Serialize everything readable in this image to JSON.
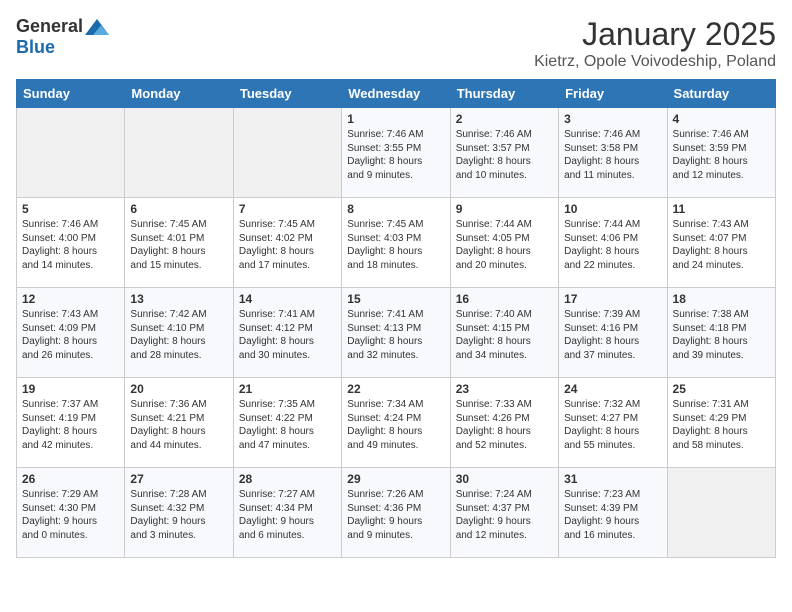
{
  "logo": {
    "general": "General",
    "blue": "Blue"
  },
  "title": "January 2025",
  "location": "Kietrz, Opole Voivodeship, Poland",
  "days_of_week": [
    "Sunday",
    "Monday",
    "Tuesday",
    "Wednesday",
    "Thursday",
    "Friday",
    "Saturday"
  ],
  "weeks": [
    [
      {
        "day": "",
        "content": ""
      },
      {
        "day": "",
        "content": ""
      },
      {
        "day": "",
        "content": ""
      },
      {
        "day": "1",
        "content": "Sunrise: 7:46 AM\nSunset: 3:55 PM\nDaylight: 8 hours\nand 9 minutes."
      },
      {
        "day": "2",
        "content": "Sunrise: 7:46 AM\nSunset: 3:57 PM\nDaylight: 8 hours\nand 10 minutes."
      },
      {
        "day": "3",
        "content": "Sunrise: 7:46 AM\nSunset: 3:58 PM\nDaylight: 8 hours\nand 11 minutes."
      },
      {
        "day": "4",
        "content": "Sunrise: 7:46 AM\nSunset: 3:59 PM\nDaylight: 8 hours\nand 12 minutes."
      }
    ],
    [
      {
        "day": "5",
        "content": "Sunrise: 7:46 AM\nSunset: 4:00 PM\nDaylight: 8 hours\nand 14 minutes."
      },
      {
        "day": "6",
        "content": "Sunrise: 7:45 AM\nSunset: 4:01 PM\nDaylight: 8 hours\nand 15 minutes."
      },
      {
        "day": "7",
        "content": "Sunrise: 7:45 AM\nSunset: 4:02 PM\nDaylight: 8 hours\nand 17 minutes."
      },
      {
        "day": "8",
        "content": "Sunrise: 7:45 AM\nSunset: 4:03 PM\nDaylight: 8 hours\nand 18 minutes."
      },
      {
        "day": "9",
        "content": "Sunrise: 7:44 AM\nSunset: 4:05 PM\nDaylight: 8 hours\nand 20 minutes."
      },
      {
        "day": "10",
        "content": "Sunrise: 7:44 AM\nSunset: 4:06 PM\nDaylight: 8 hours\nand 22 minutes."
      },
      {
        "day": "11",
        "content": "Sunrise: 7:43 AM\nSunset: 4:07 PM\nDaylight: 8 hours\nand 24 minutes."
      }
    ],
    [
      {
        "day": "12",
        "content": "Sunrise: 7:43 AM\nSunset: 4:09 PM\nDaylight: 8 hours\nand 26 minutes."
      },
      {
        "day": "13",
        "content": "Sunrise: 7:42 AM\nSunset: 4:10 PM\nDaylight: 8 hours\nand 28 minutes."
      },
      {
        "day": "14",
        "content": "Sunrise: 7:41 AM\nSunset: 4:12 PM\nDaylight: 8 hours\nand 30 minutes."
      },
      {
        "day": "15",
        "content": "Sunrise: 7:41 AM\nSunset: 4:13 PM\nDaylight: 8 hours\nand 32 minutes."
      },
      {
        "day": "16",
        "content": "Sunrise: 7:40 AM\nSunset: 4:15 PM\nDaylight: 8 hours\nand 34 minutes."
      },
      {
        "day": "17",
        "content": "Sunrise: 7:39 AM\nSunset: 4:16 PM\nDaylight: 8 hours\nand 37 minutes."
      },
      {
        "day": "18",
        "content": "Sunrise: 7:38 AM\nSunset: 4:18 PM\nDaylight: 8 hours\nand 39 minutes."
      }
    ],
    [
      {
        "day": "19",
        "content": "Sunrise: 7:37 AM\nSunset: 4:19 PM\nDaylight: 8 hours\nand 42 minutes."
      },
      {
        "day": "20",
        "content": "Sunrise: 7:36 AM\nSunset: 4:21 PM\nDaylight: 8 hours\nand 44 minutes."
      },
      {
        "day": "21",
        "content": "Sunrise: 7:35 AM\nSunset: 4:22 PM\nDaylight: 8 hours\nand 47 minutes."
      },
      {
        "day": "22",
        "content": "Sunrise: 7:34 AM\nSunset: 4:24 PM\nDaylight: 8 hours\nand 49 minutes."
      },
      {
        "day": "23",
        "content": "Sunrise: 7:33 AM\nSunset: 4:26 PM\nDaylight: 8 hours\nand 52 minutes."
      },
      {
        "day": "24",
        "content": "Sunrise: 7:32 AM\nSunset: 4:27 PM\nDaylight: 8 hours\nand 55 minutes."
      },
      {
        "day": "25",
        "content": "Sunrise: 7:31 AM\nSunset: 4:29 PM\nDaylight: 8 hours\nand 58 minutes."
      }
    ],
    [
      {
        "day": "26",
        "content": "Sunrise: 7:29 AM\nSunset: 4:30 PM\nDaylight: 9 hours\nand 0 minutes."
      },
      {
        "day": "27",
        "content": "Sunrise: 7:28 AM\nSunset: 4:32 PM\nDaylight: 9 hours\nand 3 minutes."
      },
      {
        "day": "28",
        "content": "Sunrise: 7:27 AM\nSunset: 4:34 PM\nDaylight: 9 hours\nand 6 minutes."
      },
      {
        "day": "29",
        "content": "Sunrise: 7:26 AM\nSunset: 4:36 PM\nDaylight: 9 hours\nand 9 minutes."
      },
      {
        "day": "30",
        "content": "Sunrise: 7:24 AM\nSunset: 4:37 PM\nDaylight: 9 hours\nand 12 minutes."
      },
      {
        "day": "31",
        "content": "Sunrise: 7:23 AM\nSunset: 4:39 PM\nDaylight: 9 hours\nand 16 minutes."
      },
      {
        "day": "",
        "content": ""
      }
    ]
  ]
}
